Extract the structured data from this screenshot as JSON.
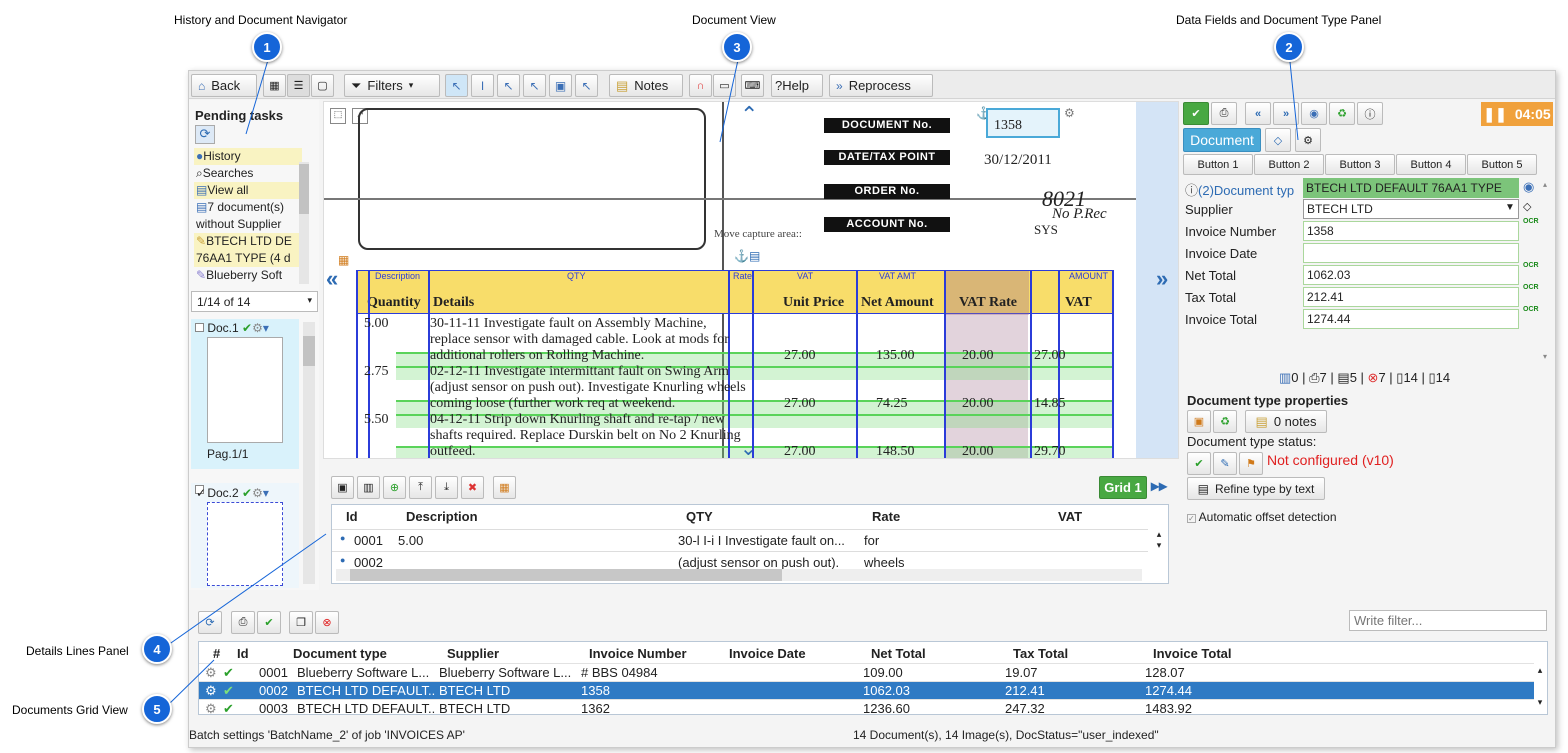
{
  "callouts": {
    "c1": {
      "num": "1",
      "label": "History and Document Navigator"
    },
    "c2": {
      "num": "2",
      "label": "Data Fields and Document Type Panel"
    },
    "c3": {
      "num": "3",
      "label": "Document View"
    },
    "c4": {
      "num": "4",
      "label": "Details Lines Panel"
    },
    "c5": {
      "num": "5",
      "label": "Documents Grid View"
    }
  },
  "toolbar": {
    "back": "Back",
    "filters": "Filters",
    "notes": "Notes",
    "help": "?Help",
    "reprocess": "Reprocess"
  },
  "left": {
    "pending_title": "Pending tasks",
    "items": [
      "History",
      "Searches",
      "View all",
      "7 document(s)",
      "without Supplier",
      "BTECH LTD DE",
      "76AA1 TYPE (4 d",
      "Blueberry Soft"
    ],
    "pager": "1/14 of 14",
    "doc1_title": "Doc.1",
    "doc1_page": "Pag.1/1",
    "doc2_title": "Doc.2"
  },
  "docview": {
    "document_no": "DOCUMENT No.",
    "date_tax": "DATE/TAX POINT",
    "order_no": "ORDER No.",
    "account_no": "ACCOUNT No.",
    "doc_value": "1358",
    "date_value": "30/12/2011",
    "move_capture": "Move capture area::",
    "handwriting": "8021",
    "handwriting2": "No P.Rec",
    "handwriting3": "SYS",
    "col_description": "Description",
    "col_qty": "QTY",
    "col_rate": "Rate",
    "col_vat": "VAT",
    "col_vatamt": "VAT AMT",
    "col_amount": "AMOUNT",
    "h_quantity": "Quantity",
    "h_details": "Details",
    "h_unit_price": "Unit Price",
    "h_net_amount": "Net Amount",
    "h_vat_rate": "VAT Rate",
    "h_vat": "VAT",
    "lines": [
      {
        "qty": "5.00",
        "text": "30-11-11 Investigate fault on Assembly Machine,"
      },
      {
        "qty": "",
        "text": "replace sensor with damaged cable. Look at mods for"
      },
      {
        "qty": "",
        "text": "additional rollers on Rolling Machine.",
        "price": "27.00",
        "net": "135.00",
        "rate": "20.00",
        "vat": "27.00"
      },
      {
        "qty": "2.75",
        "text": "02-12-11 Investigate intermittant fault on Swing Arm"
      },
      {
        "qty": "",
        "text": "(adjust sensor on push out). Investigate Knurling wheels"
      },
      {
        "qty": "",
        "text": "coming loose (further work req at weekend.",
        "price": "27.00",
        "net": "74.25",
        "rate": "20.00",
        "vat": "14.85"
      },
      {
        "qty": "5.50",
        "text": "04-12-11 Strip down Knurling shaft and re-tap / new"
      },
      {
        "qty": "",
        "text": "shafts required. Replace Durskin belt on No 2 Knurling"
      },
      {
        "qty": "",
        "text": "outfeed.",
        "price": "27.00",
        "net": "148.50",
        "rate": "20.00",
        "vat": "29.70"
      }
    ]
  },
  "details": {
    "grid_button": "Grid 1",
    "headers": [
      "Id",
      "Description",
      "QTY",
      "Rate",
      "VAT"
    ],
    "rows": [
      {
        "id": "0001",
        "desc": "5.00",
        "qty": "30-l I-i I Investigate fault on...",
        "rate": "for",
        "vat": ""
      },
      {
        "id": "0002",
        "desc": "",
        "qty": "(adjust sensor on push out).",
        "rate": "wheels",
        "vat": ""
      }
    ]
  },
  "right": {
    "timer": "04:05",
    "tab_document": "Document",
    "buttons": [
      "Button 1",
      "Button 2",
      "Button 3",
      "Button 4",
      "Button 5"
    ],
    "doctype_label": "(2)Document typ",
    "doctype_value": "BTECH LTD DEFAULT 76AA1 TYPE",
    "fields": [
      {
        "label": "Supplier",
        "value": "BTECH LTD"
      },
      {
        "label": "Invoice Number",
        "value": "1358"
      },
      {
        "label": "Invoice Date",
        "value": ""
      },
      {
        "label": "Net Total",
        "value": "1062.03"
      },
      {
        "label": "Tax Total",
        "value": "212.41"
      },
      {
        "label": "Invoice Total",
        "value": "1274.44"
      }
    ],
    "ocr": "OCR",
    "counts": [
      "0",
      "7",
      "5",
      "7",
      "14",
      "14"
    ],
    "props_title": "Document type properties",
    "notes": "0 notes",
    "status_label": "Document type status:",
    "not_configured": "Not configured (v10)",
    "refine": "Refine type by text",
    "auto_offset": "Automatic offset detection"
  },
  "bottom": {
    "filter_placeholder": "Write filter...",
    "headers": [
      "#",
      "Id",
      "Document type",
      "Supplier",
      "Invoice Number",
      "Invoice Date",
      "Net Total",
      "Tax Total",
      "Invoice Total"
    ],
    "rows": [
      {
        "id": "0001",
        "type": "Blueberry Software L...",
        "supplier": "Blueberry Software L...",
        "number": "# BBS 04984",
        "date": "",
        "net": "109.00",
        "tax": "19.07",
        "total": "128.07"
      },
      {
        "id": "0002",
        "type": "BTECH LTD DEFAULT...",
        "supplier": "BTECH LTD",
        "number": "1358",
        "date": "",
        "net": "1062.03",
        "tax": "212.41",
        "total": "1274.44"
      },
      {
        "id": "0003",
        "type": "BTECH LTD DEFAULT...",
        "supplier": "BTECH LTD",
        "number": "1362",
        "date": "",
        "net": "1236.60",
        "tax": "247.32",
        "total": "1483.92"
      }
    ],
    "status_left": "Batch settings 'BatchName_2' of job 'INVOICES AP'",
    "status_right": "14 Document(s), 14 Image(s), DocStatus=\"user_indexed\""
  },
  "colors": {
    "accent": "#1565d8",
    "selected_row": "#2f7ac4",
    "timer": "#f0a13c",
    "doc_tab": "#4aa9d8",
    "error": "#e02020"
  }
}
